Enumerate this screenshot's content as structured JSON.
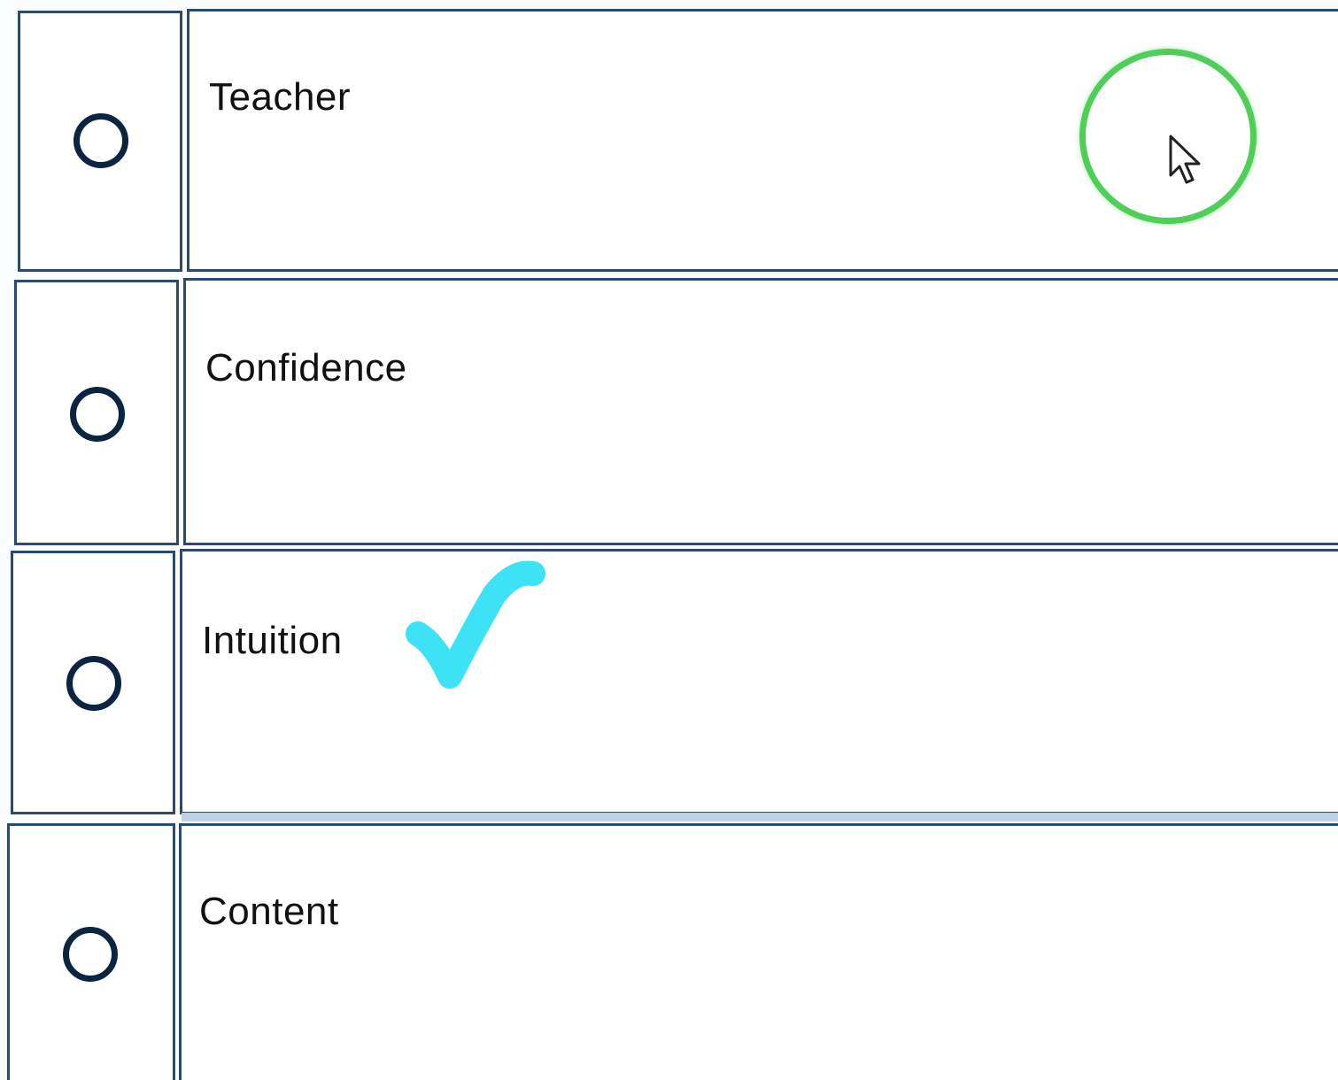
{
  "options": [
    {
      "label": "Teacher",
      "selected": false
    },
    {
      "label": "Confidence",
      "selected": false
    },
    {
      "label": "Intuition",
      "selected": false
    },
    {
      "label": "Content",
      "selected": false
    }
  ],
  "annotations": {
    "focus_ring_color": "#4fcf5a",
    "checkmark_color": "#3ee2f6",
    "checkmark_target": "Intuition"
  },
  "icons": {
    "cursor": "mouse-pointer-icon",
    "checkmark": "checkmark-icon",
    "radio": "radio-circle-icon"
  }
}
